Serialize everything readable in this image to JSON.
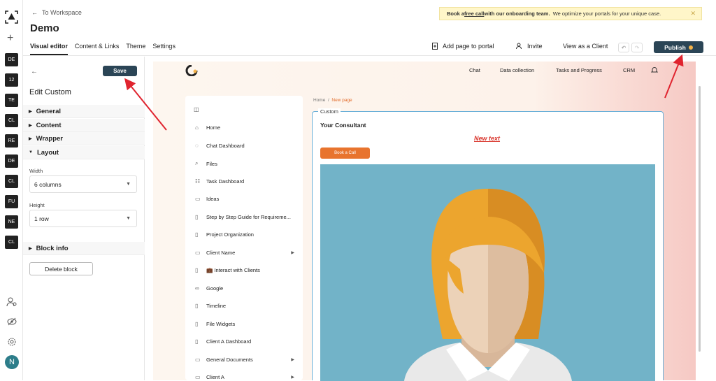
{
  "rail": {
    "workspaces": [
      "DE",
      "12",
      "TE",
      "CL",
      "RE",
      "DE",
      "CL",
      "FU",
      "NE",
      "CL"
    ],
    "avatar": "N"
  },
  "header": {
    "back_link": "To Workspace",
    "title": "Demo",
    "tabs": [
      "Visual editor",
      "Content & Links",
      "Theme",
      "Settings"
    ],
    "banner": {
      "pre": "Book a ",
      "link": "free call",
      "mid": " with our onboarding team.",
      "post": "We optimize your portals for your unique case.",
      "close": "✕"
    },
    "actions": {
      "add_page": "Add page to portal",
      "invite": "Invite",
      "view_client": "View as a Client",
      "publish": "Publish"
    }
  },
  "panel": {
    "save": "Save",
    "title": "Edit Custom",
    "sections": [
      "General",
      "Content",
      "Wrapper",
      "Layout",
      "Block info"
    ],
    "width_label": "Width",
    "width_value": "6 columns",
    "height_label": "Height",
    "height_value": "1 row",
    "delete": "Delete block"
  },
  "site": {
    "nav": [
      "Chat",
      "Data collection",
      "Tasks and Progress",
      "CRM"
    ],
    "sidenav": [
      {
        "label": "Home",
        "icon": "⌂"
      },
      {
        "label": "Chat Dashboard",
        "icon": "◌"
      },
      {
        "label": "Files",
        "icon": "⌕"
      },
      {
        "label": "Task Dashboard",
        "icon": "☷"
      },
      {
        "label": "Ideas",
        "icon": "▭"
      },
      {
        "label": "Step by Step Guide for Requireme...",
        "icon": "▯"
      },
      {
        "label": "Project Organization",
        "icon": "▯"
      },
      {
        "label": "Client Name",
        "icon": "▭",
        "arrow": true
      },
      {
        "label": "💼 Interact with Clients",
        "icon": "▯"
      },
      {
        "label": "Google",
        "icon": "∞"
      },
      {
        "label": "Timeline",
        "icon": "▯"
      },
      {
        "label": "File Widgets",
        "icon": "▯"
      },
      {
        "label": "Client A Dashboard",
        "icon": "▯"
      },
      {
        "label": "General Documents",
        "icon": "▭",
        "arrow": true
      },
      {
        "label": "Client A",
        "icon": "▭",
        "arrow": true
      }
    ],
    "breadcrumb_home": "Home",
    "breadcrumb_sep": "/",
    "breadcrumb_current": "New page",
    "block_tag": "Custom",
    "block_heading": "Your Consultant",
    "new_text": "New text",
    "book_call": "Book a Call"
  },
  "colors": {
    "publish_bg": "#2b4556",
    "accent_orange": "#e8742e",
    "new_text_red": "#d9342b",
    "annotation_arrow": "#e0242f"
  }
}
